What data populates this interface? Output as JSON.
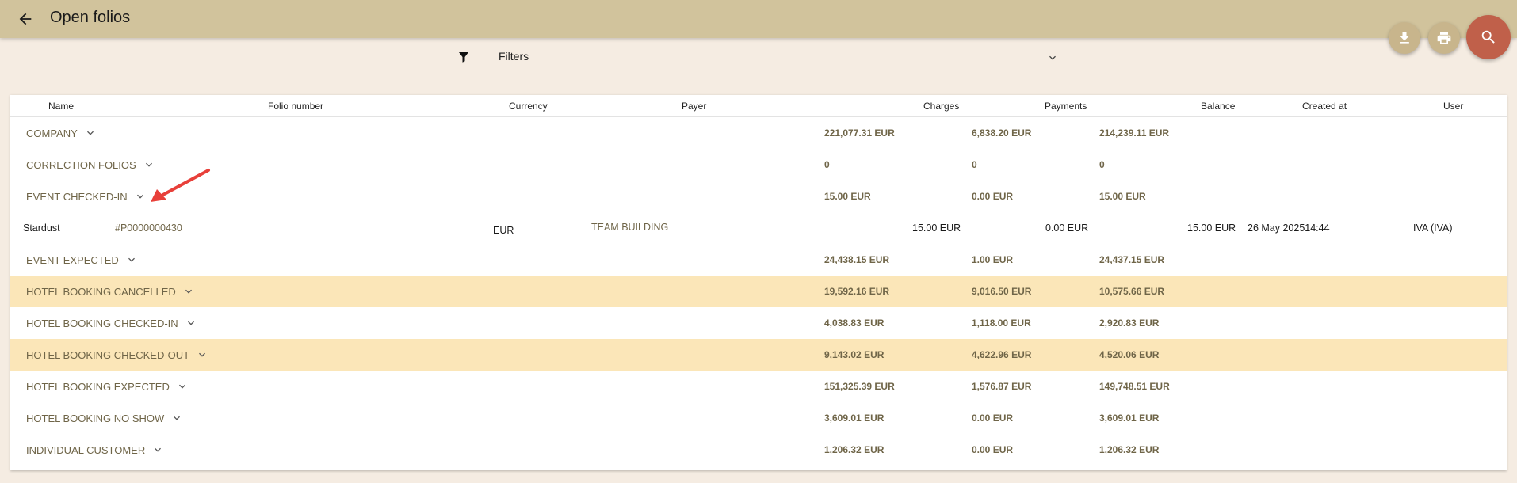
{
  "header": {
    "title": "Open folios"
  },
  "filters": {
    "label": "Filters"
  },
  "columns": {
    "name": "Name",
    "folio_number": "Folio number",
    "currency": "Currency",
    "payer": "Payer",
    "charges": "Charges",
    "payments": "Payments",
    "balance": "Balance",
    "created_at": "Created at",
    "user": "User"
  },
  "groups": [
    {
      "label": "COMPANY",
      "charges": "221,077.31",
      "charges_cur": "EUR",
      "payments": "6,838.20",
      "payments_cur": "EUR",
      "balance": "214,239.11",
      "balance_cur": "EUR",
      "highlighted": false
    },
    {
      "label": "CORRECTION FOLIOS",
      "charges": "0",
      "charges_cur": "",
      "payments": "0",
      "payments_cur": "",
      "balance": "0",
      "balance_cur": "",
      "highlighted": false
    },
    {
      "label": "EVENT CHECKED-IN",
      "charges": "15.00",
      "charges_cur": "EUR",
      "payments": "0.00",
      "payments_cur": "EUR",
      "balance": "15.00",
      "balance_cur": "EUR",
      "highlighted": false
    },
    {
      "label": "EVENT EXPECTED",
      "charges": "24,438.15",
      "charges_cur": "EUR",
      "payments": "1.00",
      "payments_cur": "EUR",
      "balance": "24,437.15",
      "balance_cur": "EUR",
      "highlighted": false
    },
    {
      "label": "HOTEL BOOKING CANCELLED",
      "charges": "19,592.16",
      "charges_cur": "EUR",
      "payments": "9,016.50",
      "payments_cur": "EUR",
      "balance": "10,575.66",
      "balance_cur": "EUR",
      "highlighted": true
    },
    {
      "label": "HOTEL BOOKING CHECKED-IN",
      "charges": "4,038.83",
      "charges_cur": "EUR",
      "payments": "1,118.00",
      "payments_cur": "EUR",
      "balance": "2,920.83",
      "balance_cur": "EUR",
      "highlighted": false
    },
    {
      "label": "HOTEL BOOKING CHECKED-OUT",
      "charges": "9,143.02",
      "charges_cur": "EUR",
      "payments": "4,622.96",
      "payments_cur": "EUR",
      "balance": "4,520.06",
      "balance_cur": "EUR",
      "highlighted": true
    },
    {
      "label": "HOTEL BOOKING EXPECTED",
      "charges": "151,325.39",
      "charges_cur": "EUR",
      "payments": "1,576.87",
      "payments_cur": "EUR",
      "balance": "149,748.51",
      "balance_cur": "EUR",
      "highlighted": false
    },
    {
      "label": "HOTEL BOOKING NO SHOW",
      "charges": "3,609.01",
      "charges_cur": "EUR",
      "payments": "0.00",
      "payments_cur": "EUR",
      "balance": "3,609.01",
      "balance_cur": "EUR",
      "highlighted": false
    },
    {
      "label": "INDIVIDUAL CUSTOMER",
      "charges": "1,206.32",
      "charges_cur": "EUR",
      "payments": "0.00",
      "payments_cur": "EUR",
      "balance": "1,206.32",
      "balance_cur": "EUR",
      "highlighted": false
    }
  ],
  "detail_row": {
    "name": "Stardust",
    "folio_number": "#P0000000430",
    "currency": "EUR",
    "payer": "TEAM BUILDING",
    "charges": "15.00 EUR",
    "payments": "0.00 EUR",
    "balance": "15.00 EUR",
    "created_at": "26 May 202514:44",
    "user": "IVA (IVA)"
  },
  "icons": {
    "back": "arrow-back-icon",
    "download": "download-icon",
    "print": "print-icon",
    "search": "search-icon",
    "filter": "filter-icon",
    "chevron": "chevron-down-icon"
  },
  "colors": {
    "topbar": "#d1c39c",
    "highlight_row": "#fbe6b8",
    "search_fab": "#c0604a",
    "annotation_arrow": "#e8403a"
  }
}
